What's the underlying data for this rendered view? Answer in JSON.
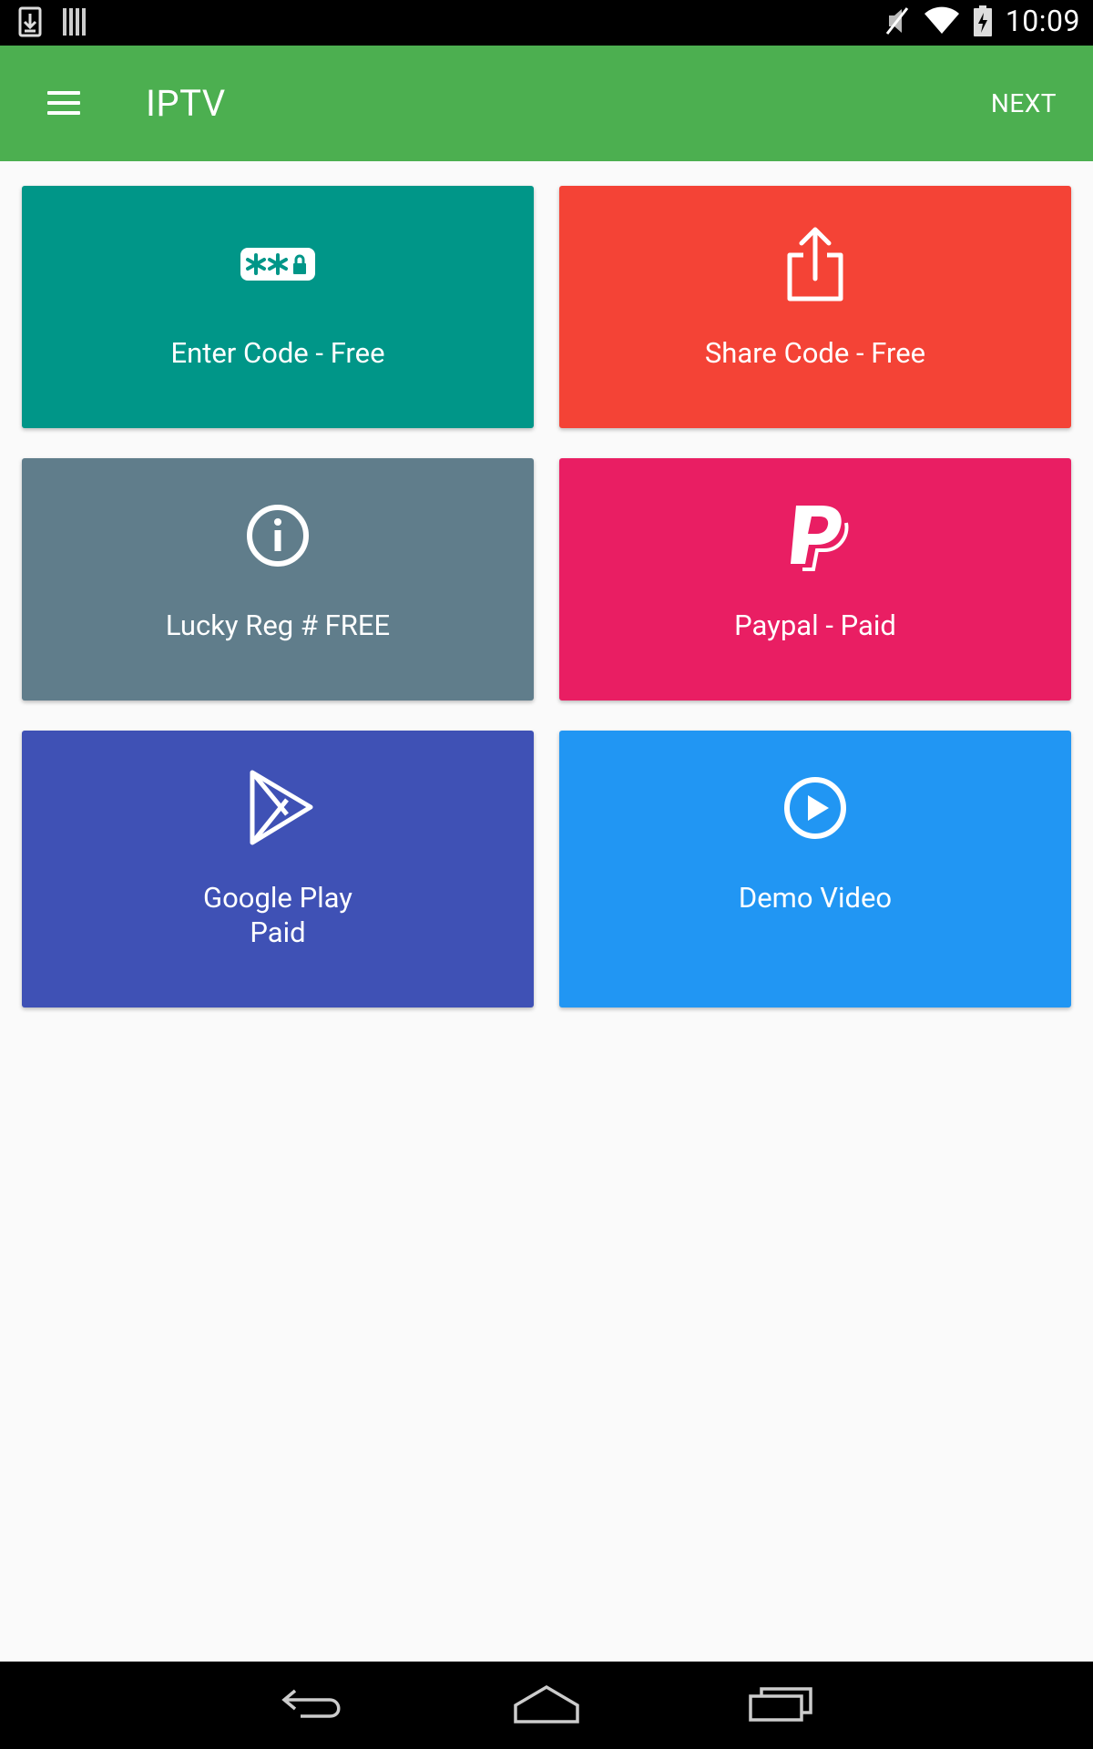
{
  "status_bar": {
    "time": "10:09",
    "left_icons": [
      "download-icon",
      "barcode-icon"
    ],
    "right_icons": [
      "mute-icon",
      "wifi-icon",
      "battery-charging-icon"
    ]
  },
  "app_bar": {
    "title": "IPTV",
    "next_label": "NEXT",
    "color": "#4caf50"
  },
  "tiles": [
    {
      "label": "Enter Code - Free",
      "icon": "password-icon",
      "color": "#009688"
    },
    {
      "label": "Share Code - Free",
      "icon": "share-icon",
      "color": "#f44336"
    },
    {
      "label": "Lucky Reg # FREE",
      "icon": "info-icon",
      "color": "#607d8b"
    },
    {
      "label": "Paypal - Paid",
      "icon": "paypal-icon",
      "color": "#e91e63"
    },
    {
      "label": "Google Play\nPaid",
      "icon": "google-play-icon",
      "color": "#3f51b5"
    },
    {
      "label": "Demo Video",
      "icon": "play-circle-icon",
      "color": "#2196f3"
    }
  ],
  "nav_bar": {
    "buttons": [
      "back-icon",
      "home-icon",
      "recents-icon"
    ]
  }
}
